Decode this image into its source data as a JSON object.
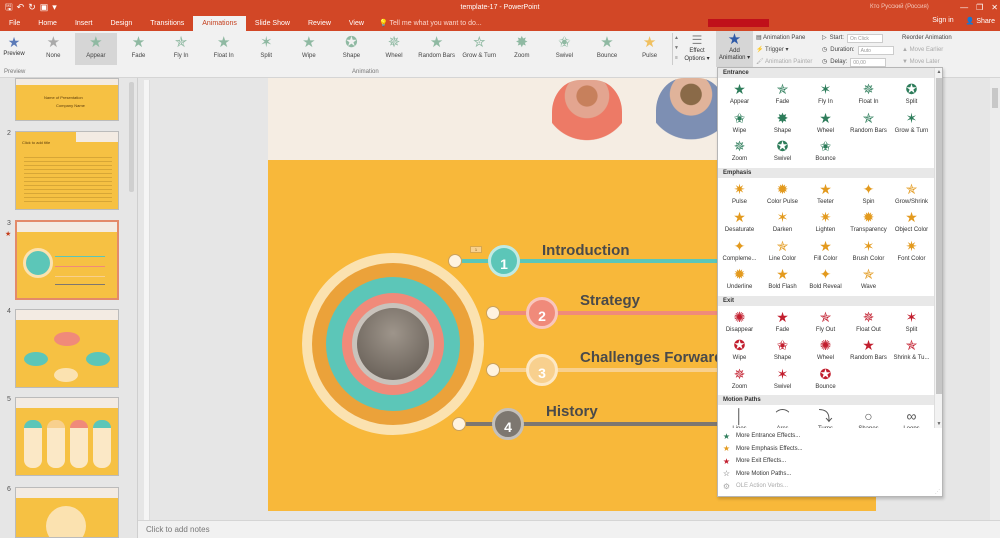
{
  "titlebar": {
    "doc_title": "template-17 - PowerPoint",
    "user": "Кто Русский (Россия)",
    "window_controls": [
      "—",
      "❐",
      "✕"
    ]
  },
  "tabs": {
    "items": [
      "File",
      "Home",
      "Insert",
      "Design",
      "Transitions",
      "Animations",
      "Slide Show",
      "Review",
      "View"
    ],
    "active": "Animations",
    "tell_me": "Tell me what you want to do...",
    "sign_in": "Sign in",
    "share": "Share"
  },
  "ribbon": {
    "preview_label": "Preview",
    "preview_group_label": "Preview",
    "animation_group_label": "Animation",
    "gallery": [
      "None",
      "Appear",
      "Fade",
      "Fly In",
      "Float In",
      "Split",
      "Wipe",
      "Shape",
      "Wheel",
      "Random Bars",
      "Grow & Turn",
      "Zoom",
      "Swivel",
      "Bounce",
      "Pulse"
    ],
    "gallery_selected": "Appear",
    "effect_options": [
      "Effect",
      "Options"
    ],
    "add_animation": [
      "Add",
      "Animation"
    ],
    "animation_pane": "Animation Pane",
    "trigger": "Trigger",
    "animation_painter": "Animation Painter",
    "start_label": "Start:",
    "start_value": "On Click",
    "duration_label": "Duration:",
    "duration_value": "Auto",
    "delay_label": "Delay:",
    "delay_value": "00,00",
    "reorder_label": "Reorder Animation",
    "move_earlier": "Move Earlier",
    "move_later": "Move Later"
  },
  "slides": {
    "numbers": [
      "2",
      "3",
      "4",
      "5",
      "6"
    ],
    "thumb1_title": "Name of Presentation",
    "thumb1_sub": "Company Name",
    "thumb2_title": "Click to add title"
  },
  "slide": {
    "labels": [
      "Introduction",
      "Strategy",
      "Challenges Forward",
      "History"
    ],
    "numbers": [
      "1",
      "2",
      "3",
      "4"
    ],
    "hint": "1"
  },
  "notes": "Click to add notes",
  "dropdown": {
    "entrance_header": "Entrance",
    "entrance": [
      "Appear",
      "Fade",
      "Fly In",
      "Float In",
      "Split",
      "Wipe",
      "Shape",
      "Wheel",
      "Random Bars",
      "Grow & Turn",
      "Zoom",
      "Swivel",
      "Bounce"
    ],
    "emphasis_header": "Emphasis",
    "emphasis": [
      "Pulse",
      "Color Pulse",
      "Teeter",
      "Spin",
      "Grow/Shrink",
      "Desaturate",
      "Darken",
      "Lighten",
      "Transparency",
      "Object Color",
      "Compleme...",
      "Line Color",
      "Fill Color",
      "Brush Color",
      "Font Color",
      "Underline",
      "Bold Flash",
      "Bold Reveal",
      "Wave"
    ],
    "exit_header": "Exit",
    "exit": [
      "Disappear",
      "Fade",
      "Fly Out",
      "Float Out",
      "Split",
      "Wipe",
      "Shape",
      "Wheel",
      "Random Bars",
      "Shrink & Tu...",
      "Zoom",
      "Swivel",
      "Bounce"
    ],
    "motion_header": "Motion Paths",
    "motion": [
      "Lines",
      "Arcs",
      "Turns",
      "Shapes",
      "Loops"
    ],
    "more": [
      "More Entrance Effects...",
      "More Emphasis Effects...",
      "More Exit Effects...",
      "More Motion Paths...",
      "OLE Action Verbs..."
    ]
  },
  "colors": {
    "accent": "#d24726",
    "entrance": "#2e7d5b",
    "emphasis": "#e39a1e",
    "exit": "#c21e2e",
    "slide_bg": "#f8b83a"
  }
}
